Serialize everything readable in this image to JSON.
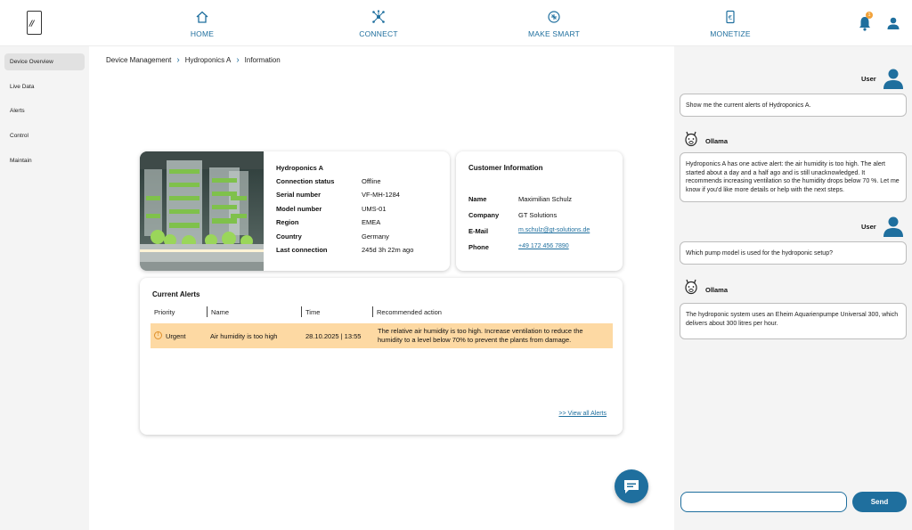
{
  "nav": {
    "items": [
      {
        "label": "HOME",
        "icon": "home-icon"
      },
      {
        "label": "CONNECT",
        "icon": "connect-icon"
      },
      {
        "label": "MAKE SMART",
        "icon": "make-smart-icon"
      },
      {
        "label": "MONETIZE",
        "icon": "monetize-icon"
      }
    ],
    "notification_count": "1",
    "accent_color": "#1f6f9e",
    "badge_color": "#f2a23a"
  },
  "sidebar": {
    "items": [
      {
        "label": "Device Overview",
        "active": true
      },
      {
        "label": "Live Data",
        "active": false
      },
      {
        "label": "Alerts",
        "active": false
      },
      {
        "label": "Control",
        "active": false
      },
      {
        "label": "Maintain",
        "active": false
      }
    ]
  },
  "breadcrumb": [
    "Device Management",
    "Hydroponics A",
    "Information"
  ],
  "device": {
    "name": "Hydroponics A",
    "fields": [
      {
        "label": "Connection status",
        "value": "Offline"
      },
      {
        "label": "Serial number",
        "value": "VF-MH-1284"
      },
      {
        "label": "Model number",
        "value": "UMS-01"
      },
      {
        "label": "Region",
        "value": "EMEA"
      },
      {
        "label": "Country",
        "value": "Germany"
      },
      {
        "label": "Last connection",
        "value": "245d 3h 22m ago"
      }
    ]
  },
  "customer": {
    "title": "Customer Information",
    "fields": [
      {
        "label": "Name",
        "value": "Maximilian Schulz"
      },
      {
        "label": "Company",
        "value": "GT Solutions"
      },
      {
        "label": "E-Mail",
        "value": "m.schulz@gt-solutions.de"
      },
      {
        "label": "Phone",
        "value": "+49 172 456 7890"
      }
    ]
  },
  "alerts": {
    "title": "Current Alerts",
    "columns": [
      "Priority",
      "Name",
      "Time",
      "Recommended action"
    ],
    "rows": [
      {
        "priority": "Urgent",
        "name": "Air humidity is too high",
        "time": "28.10.2025 | 13:55",
        "action": "The relative air humidity is too high. Increase ventilation to reduce the humidity to a level below 70% to prevent the plants from damage."
      }
    ],
    "view_all": ">> View all Alerts",
    "row_color": "#fdd9a3"
  },
  "chat": {
    "messages": [
      {
        "sender": "User",
        "text": "Show me the current alerts of Hydroponics A."
      },
      {
        "sender": "Ollama",
        "text": "Hydroponics A has one active alert: the air humidity is too high. The alert started about a day and a half ago and is still unacknowledged. It recommends increasing ventilation so the humidity drops below 70 %. Let me know if you'd like more details or help with the next steps."
      },
      {
        "sender": "User",
        "text": "Which pump model is used for the hydroponic setup?"
      },
      {
        "sender": "Ollama",
        "text": "The hydroponic system uses an Eheim Aquarienpumpe Universal 300, which delivers about 300 litres per hour."
      }
    ],
    "input_placeholder": "",
    "send_label": "Send"
  }
}
